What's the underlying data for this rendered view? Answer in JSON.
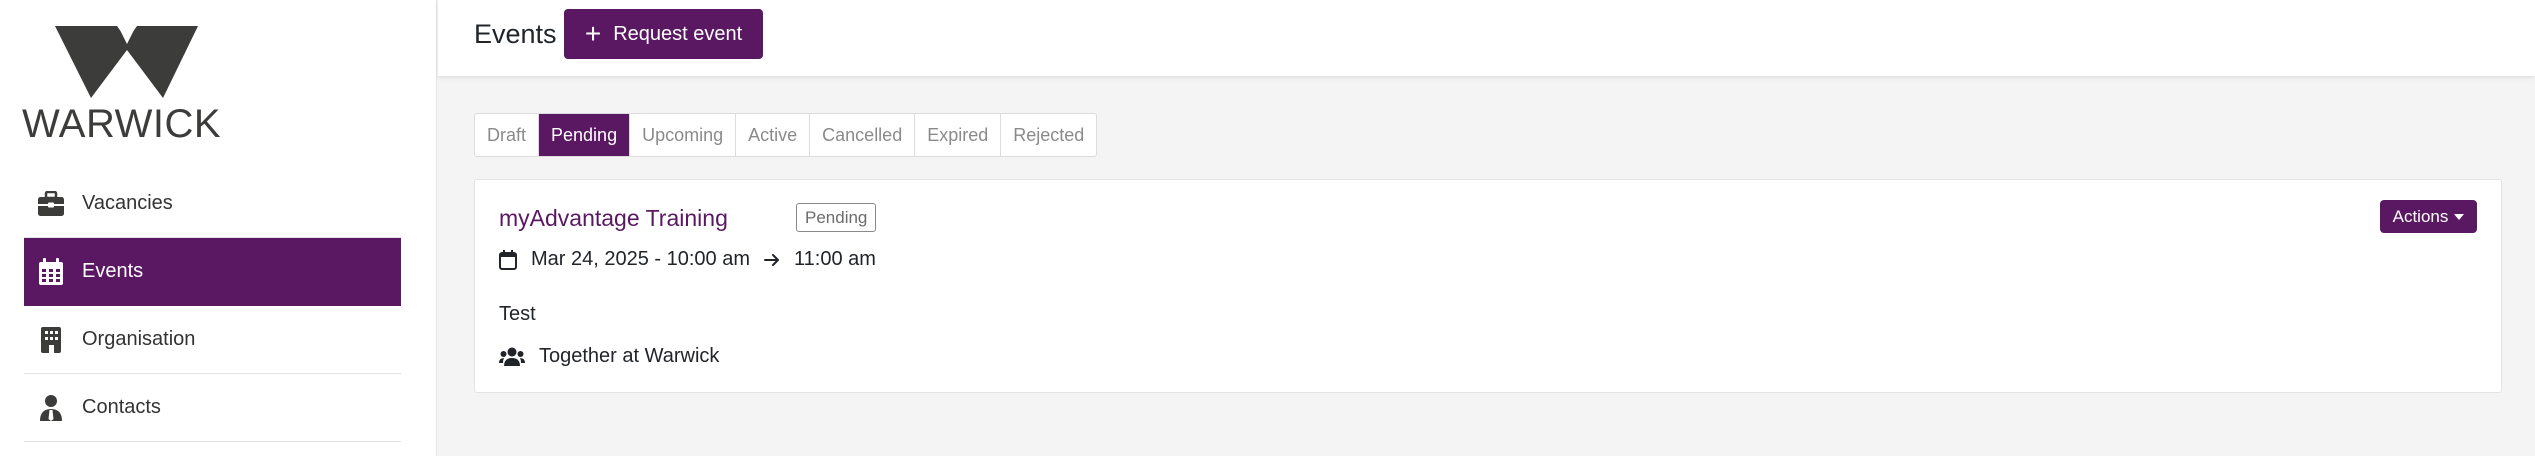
{
  "brand": {
    "logo_text": "WARWICK",
    "accent_color": "#5a1863"
  },
  "sidebar": {
    "items": [
      {
        "label": "Vacancies",
        "icon": "briefcase-icon",
        "active": false
      },
      {
        "label": "Events",
        "icon": "calendar-icon",
        "active": true
      },
      {
        "label": "Organisation",
        "icon": "building-icon",
        "active": false
      },
      {
        "label": "Contacts",
        "icon": "user-tie-icon",
        "active": false
      }
    ]
  },
  "header": {
    "title": "Events",
    "request_button_label": "Request event"
  },
  "tabs": [
    {
      "label": "Draft",
      "active": false
    },
    {
      "label": "Pending",
      "active": true
    },
    {
      "label": "Upcoming",
      "active": false
    },
    {
      "label": "Active",
      "active": false
    },
    {
      "label": "Cancelled",
      "active": false
    },
    {
      "label": "Expired",
      "active": false
    },
    {
      "label": "Rejected",
      "active": false
    }
  ],
  "event": {
    "title": "myAdvantage Training",
    "status": "Pending",
    "actions_label": "Actions",
    "start": "Mar 24, 2025 - 10:00 am",
    "end": "11:00 am",
    "description": "Test",
    "organisation": "Together at Warwick"
  }
}
